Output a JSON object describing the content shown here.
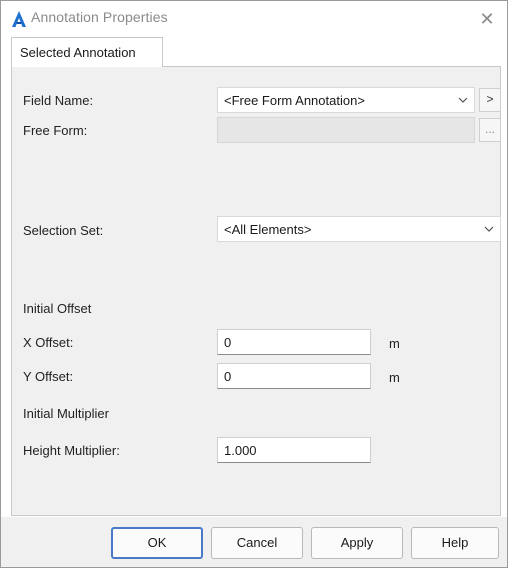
{
  "window": {
    "title": "Annotation Properties",
    "close_glyph": "✕",
    "icon": "autodesk-a-icon"
  },
  "tabs": [
    {
      "label": "Selected Annotation",
      "active": true
    }
  ],
  "form": {
    "field_name": {
      "label": "Field Name:",
      "value": "<Free Form Annotation>",
      "next_glyph": ">"
    },
    "free_form": {
      "label": "Free Form:",
      "value": "",
      "browse_glyph": "..."
    },
    "selection_set": {
      "label": "Selection Set:",
      "value": "<All Elements>"
    },
    "initial_offset": {
      "heading": "Initial Offset",
      "x": {
        "label": "X Offset:",
        "value": "0",
        "unit": "m"
      },
      "y": {
        "label": "Y Offset:",
        "value": "0",
        "unit": "m"
      }
    },
    "initial_multiplier": {
      "heading": "Initial Multiplier",
      "height": {
        "label": "Height Multiplier:",
        "value": "1.000"
      }
    }
  },
  "buttons": {
    "ok": "OK",
    "cancel": "Cancel",
    "apply": "Apply",
    "help": "Help"
  },
  "colors": {
    "accent": "#1f6fd1",
    "default_button_border": "#4a79c7",
    "panel_bg": "#f0f0f0"
  }
}
